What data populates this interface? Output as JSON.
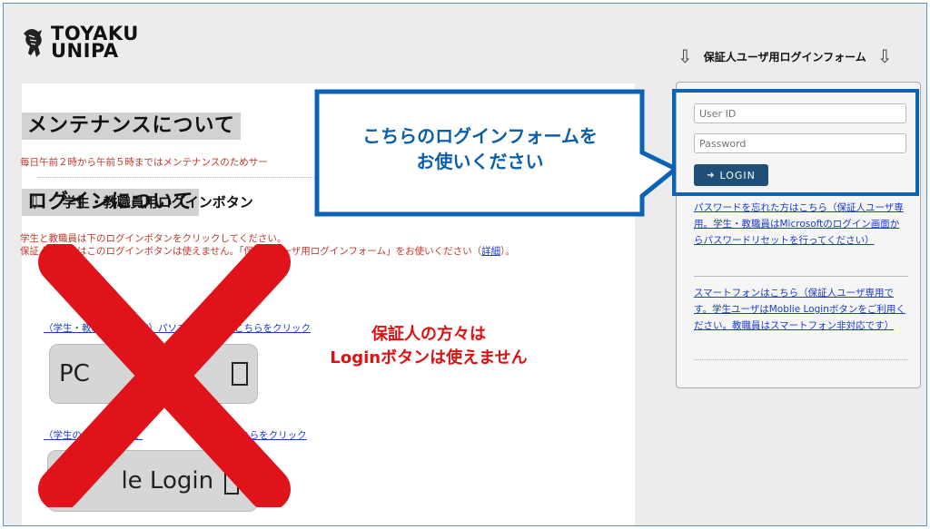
{
  "brand": {
    "line1": "TOYAKU",
    "line2": "UNIPA",
    "mark_icon": "pegasus-logo-icon"
  },
  "maintenance": {
    "heading": "メンテナンスについて",
    "text": "毎日午前２時から午前５時まではメンテナンスのためサー"
  },
  "login_section": {
    "heading": "ログインについて",
    "line1": "学生と教職員は下のログインボタンをクリックしてください。",
    "line2_prefix": "保証人の方々はこのログインボタンは使えません。「保証人ユーザ用ログインフォーム」をお使いください（",
    "detail_link": "詳細",
    "line2_suffix": "）。",
    "sub_heading": "学生・教職員用ログインボタン",
    "arrow_icon": "down-arrow-icon"
  },
  "pc_login": {
    "link": "（学生・教職員のみ対応）パソコン利用時はこちらをクリック",
    "button_left": "PC",
    "button_right": "in"
  },
  "mobile_login": {
    "link_left": "（学生のみ対応）",
    "link_mid": "こ",
    "link_right": "はこちらをクリック",
    "button_left": "M",
    "button_right": "le Login"
  },
  "annotation": {
    "callout_line1": "こちらのログインフォームを",
    "callout_line2": "お使いください",
    "warn_line1": "保証人の方々は",
    "warn_line2": "Loginボタンは使えません",
    "callout_color": "#0b63b5",
    "warn_color": "#e01010"
  },
  "guardian_form": {
    "heading": "保証人ユーザ用ログインフォーム",
    "user_placeholder": "User ID",
    "password_placeholder": "Password",
    "login_label": "LOGIN",
    "login_icon": "sign-in-icon",
    "forgot_link": "パスワードを忘れた方はこちら（保証人ユーザ専用。学生・教職員はMicrosoftのログイン画面からパスワードリセットを行ってください）",
    "smartphone_link": "スマートフォンはこちら（保証人ユーザ専用です。学生ユーザはMoblie Loginボタンをご利用ください。教職員はスマートフォン非対応です）"
  }
}
